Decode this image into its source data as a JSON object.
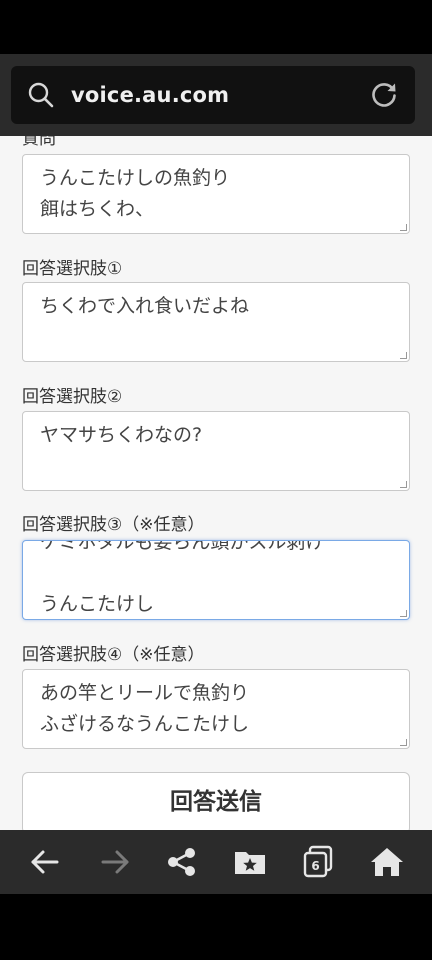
{
  "browser": {
    "url": "voice.au.com",
    "tab_count": "6"
  },
  "form": {
    "question_label": "質問",
    "question_lines": [
      "うんこたけしの魚釣り",
      "餌はちくわ、"
    ],
    "choice1_label": "回答選択肢①",
    "choice1_lines": [
      "ちくわで入れ食いだよね"
    ],
    "choice2_label": "回答選択肢②",
    "choice2_lines": [
      "ヤマサちくわなの?"
    ],
    "choice3_label": "回答選択肢③（※任意）",
    "choice3_lines": [
      "ケミホタルも要らん頭かスル剥け",
      "",
      "うんこたけし"
    ],
    "choice4_label": "回答選択肢④（※任意）",
    "choice4_lines": [
      "あの竿とリールで魚釣り",
      "ふざけるなうんこたけし"
    ],
    "submit_label": "回答送信"
  },
  "colors": {
    "toolbar_bg": "#2b2b2b",
    "url_bar_bg": "#111111",
    "page_bg": "#f6f6f6",
    "focus_border": "#7aa9e6"
  }
}
